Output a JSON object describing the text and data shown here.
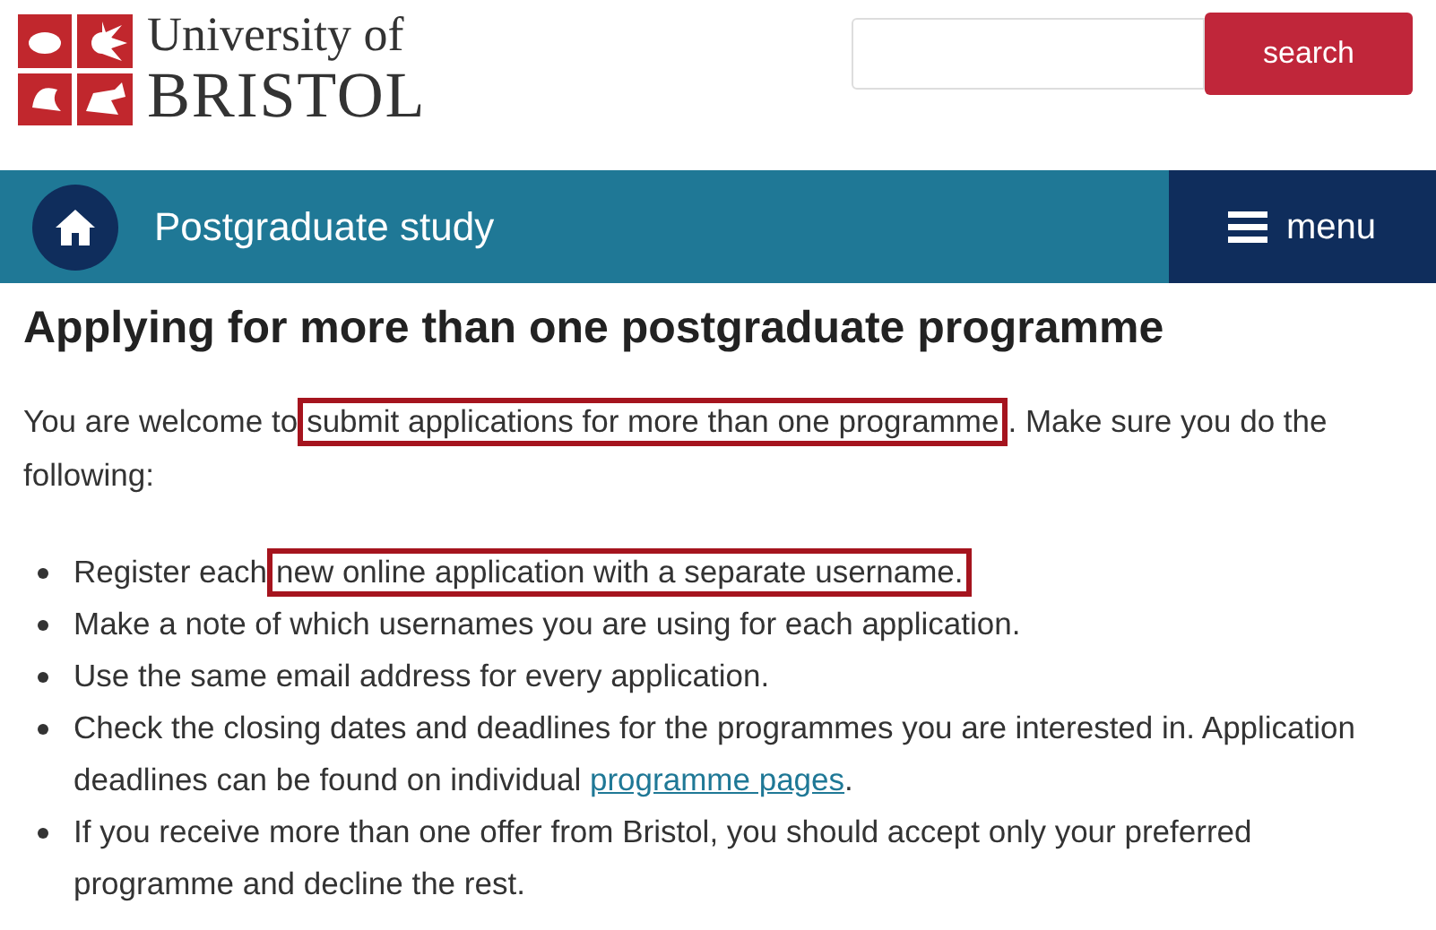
{
  "logo": {
    "line_1": "University of",
    "line_2": "BRISTOL"
  },
  "search": {
    "button": "search"
  },
  "nav_bar": {
    "title": "Postgraduate study",
    "menu": "menu"
  },
  "heading": "Applying for more than one postgraduate programme",
  "intro": [
    {
      "kind": "text",
      "text": "You are welcome to"
    },
    {
      "kind": "highlight",
      "text": "submit applications for more than one programme"
    },
    {
      "kind": "text",
      "text": ". Make sure you do the following:"
    }
  ],
  "bullets": [
    [
      {
        "kind": "text",
        "text": "Register each"
      },
      {
        "kind": "highlight",
        "text": "new online application with a separate username."
      }
    ],
    [
      {
        "kind": "text",
        "text": "Make a note of which usernames you are using for each application."
      }
    ],
    [
      {
        "kind": "text",
        "text": "Use the same email address for every application."
      }
    ],
    [
      {
        "kind": "text",
        "text": "Check the closing dates and deadlines for the programmes you are interested in. Application deadlines can be found on individual "
      },
      {
        "kind": "link",
        "text": "programme pages"
      },
      {
        "kind": "text",
        "text": "."
      }
    ],
    [
      {
        "kind": "text",
        "text": "If you receive more than one offer from Bristol, you should accept only your preferred programme and decline the rest."
      }
    ]
  ]
}
